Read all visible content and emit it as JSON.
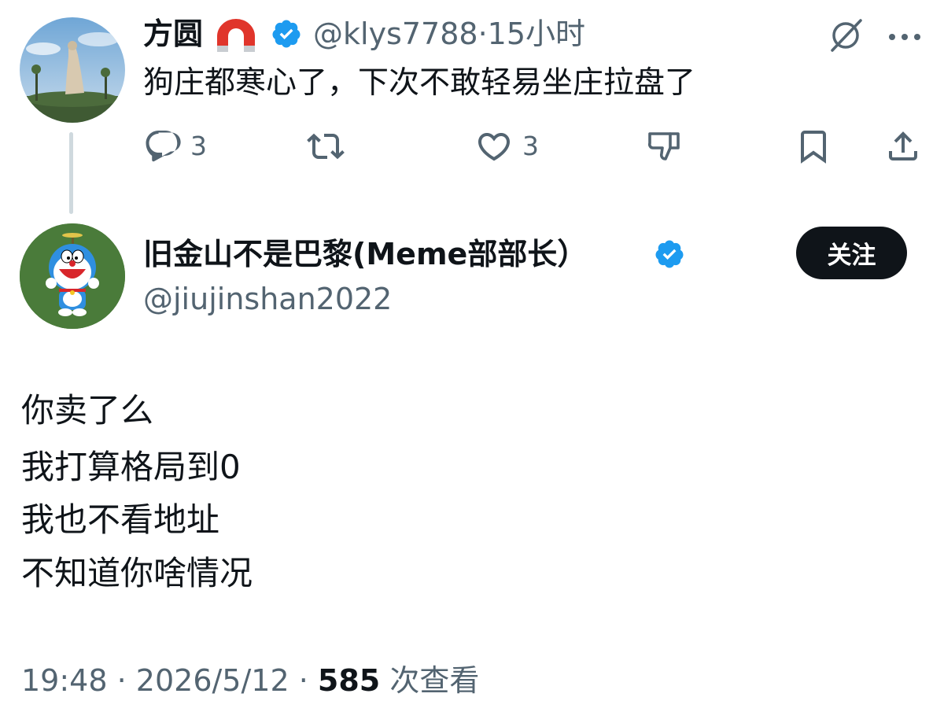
{
  "reply": {
    "display_name": "方圆",
    "emoji": "🧲",
    "handle": "@klys7788",
    "separator": "·",
    "time": "15小时",
    "text": "狗庄都寒心了，下次不敢轻易坐庄拉盘了",
    "actions": {
      "reply_count": "3",
      "like_count": "3"
    }
  },
  "main_tweet": {
    "display_name": "旧金山不是巴黎(Meme部部长）",
    "handle": "@jiujinshan2022",
    "follow_label": "关注",
    "body_lines": [
      "你卖了么",
      "我打算格局到0",
      "我也不看地址",
      "不知道你啥情况"
    ],
    "time": "19:48",
    "date": "2026/5/12",
    "separator": "·",
    "views": "585",
    "views_label": "次查看"
  },
  "colors": {
    "verified_blue": "#1d9bf0",
    "text_primary": "#0f1419",
    "text_secondary": "#536471",
    "thread_line": "#cfd9de",
    "magnet_red": "#e0352b"
  },
  "icons": [
    "verified-badge-icon",
    "magnet-emoji-icon",
    "grok-icon",
    "more-icon",
    "reply-icon",
    "retweet-icon",
    "like-icon",
    "dislike-icon",
    "bookmark-icon",
    "share-icon"
  ]
}
